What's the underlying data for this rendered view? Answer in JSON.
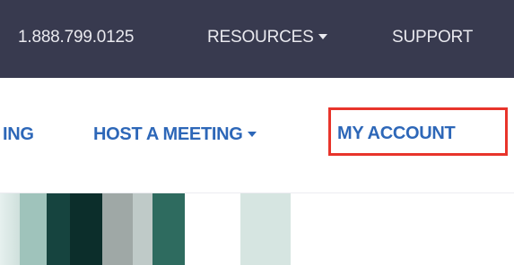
{
  "topbar": {
    "phone": "1.888.799.0125",
    "resources_label": "RESOURCES",
    "support_label": "SUPPORT",
    "bg_color": "#383a4f"
  },
  "mainnav": {
    "partial_label": "ING",
    "host_label": "HOST A MEETING",
    "account_label": "MY ACCOUNT",
    "link_color": "#2d67b8",
    "highlight_color": "#e8342b"
  },
  "icons": {
    "dropdown": "chevron-down-icon"
  }
}
